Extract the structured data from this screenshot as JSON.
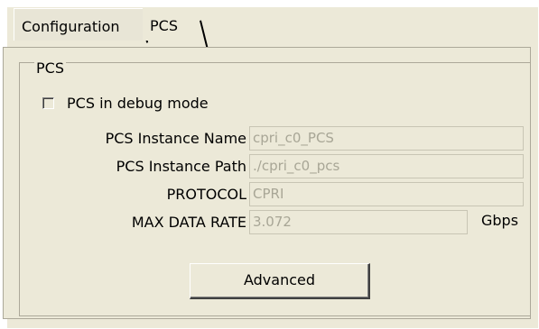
{
  "tabs": [
    {
      "label": "Configuration",
      "active": false
    },
    {
      "label": "PCS",
      "active": true
    }
  ],
  "group": {
    "title": "PCS"
  },
  "debug_checkbox": {
    "label": "PCS in debug mode",
    "checked": false
  },
  "fields": {
    "instance_name": {
      "label": "PCS Instance Name",
      "value": "cpri_c0_PCS"
    },
    "instance_path": {
      "label": "PCS Instance Path",
      "value": "./cpri_c0_pcs"
    },
    "protocol": {
      "label": "PROTOCOL",
      "value": "CPRI"
    },
    "max_data_rate": {
      "label": "MAX DATA RATE",
      "value": "3.072",
      "unit": "Gbps"
    }
  },
  "advanced_button": {
    "label": "Advanced"
  }
}
